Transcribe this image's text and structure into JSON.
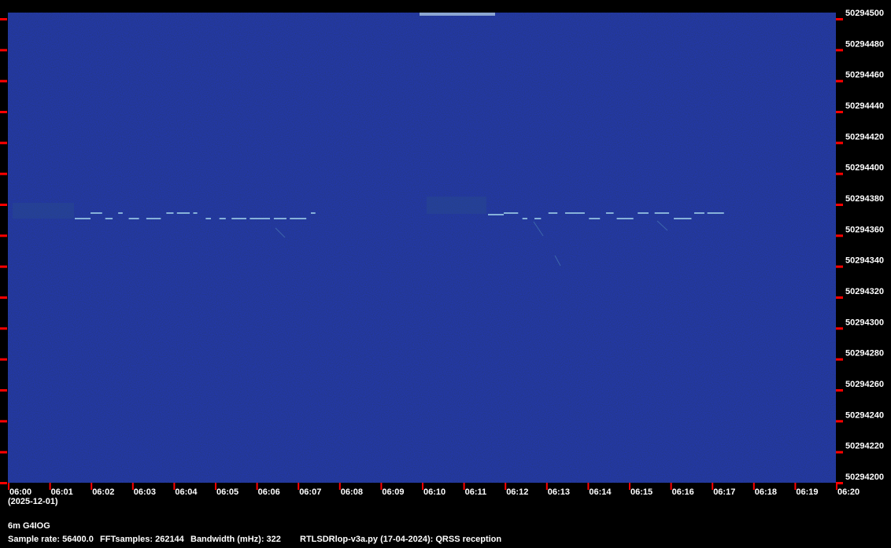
{
  "chart_data": {
    "type": "heatmap",
    "colors": {
      "background": "#0b1655",
      "signal": "#9fd0e8",
      "tick": "#ff0000",
      "text": "#ffffff"
    },
    "x_ticks": [
      "06:00",
      "06:01",
      "06:02",
      "06:03",
      "06:04",
      "06:05",
      "06:06",
      "06:07",
      "06:08",
      "06:09",
      "06:10",
      "06:11",
      "06:12",
      "06:13",
      "06:14",
      "06:15",
      "06:16",
      "06:17",
      "06:18",
      "06:19",
      "06:20"
    ],
    "y_ticks": [
      "50294500",
      "50294480",
      "50294460",
      "50294440",
      "50294420",
      "50294400",
      "50294380",
      "50294360",
      "50294340",
      "50294320",
      "50294300",
      "50294280",
      "50294260",
      "50294240",
      "50294220",
      "50294200"
    ],
    "y_range": [
      50294200,
      50294500
    ],
    "date": "(2025-12-01)"
  },
  "footer": {
    "station": "6m G4IOG",
    "sample_rate": "Sample rate: 56400.0",
    "fft_samples": "FFTsamples: 262144",
    "bandwidth": "Bandwidth (mHz): 322",
    "software": "RTLSDRlop-v3a.py (17-04-2024): QRSS reception"
  }
}
